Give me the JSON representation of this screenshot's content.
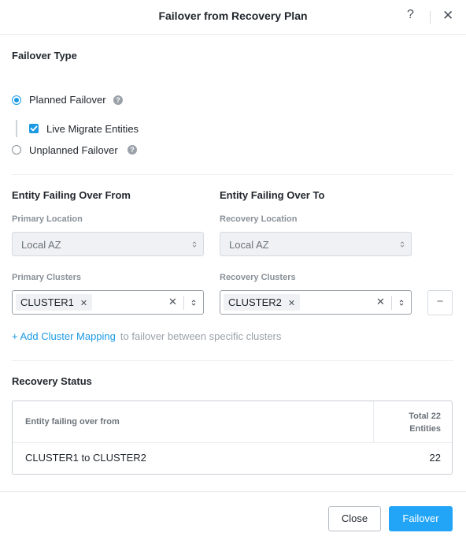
{
  "dialog": {
    "title": "Failover from Recovery Plan",
    "help_label": "?",
    "close_label": "✕"
  },
  "failover_type": {
    "heading": "Failover Type",
    "planned_label": "Planned Failover",
    "planned_selected": true,
    "live_migrate_label": "Live Migrate Entities",
    "live_migrate_checked": true,
    "unplanned_label": "Unplanned Failover",
    "unplanned_selected": false,
    "help_glyph": "?"
  },
  "from": {
    "heading": "Entity Failing Over From",
    "location_label": "Primary Location",
    "location_value": "Local AZ",
    "clusters_label": "Primary Clusters",
    "cluster_chip": "CLUSTER1"
  },
  "to": {
    "heading": "Entity Failing Over To",
    "location_label": "Recovery Location",
    "location_value": "Local AZ",
    "clusters_label": "Recovery Clusters",
    "cluster_chip": "CLUSTER2"
  },
  "mapping": {
    "remove_label": "−",
    "add_link": "+ Add Cluster Mapping",
    "add_hint": "to failover between specific clusters"
  },
  "recovery_status": {
    "heading": "Recovery Status",
    "col_left": "Entity failing over from",
    "col_right_line1": "Total 22",
    "col_right_line2": "Entities",
    "rows": [
      {
        "mapping": "CLUSTER1 to CLUSTER2",
        "count": "22"
      }
    ]
  },
  "footer": {
    "close_label": "Close",
    "failover_label": "Failover"
  },
  "colors": {
    "accent": "#22a5f7",
    "link": "#1b9ae4"
  }
}
